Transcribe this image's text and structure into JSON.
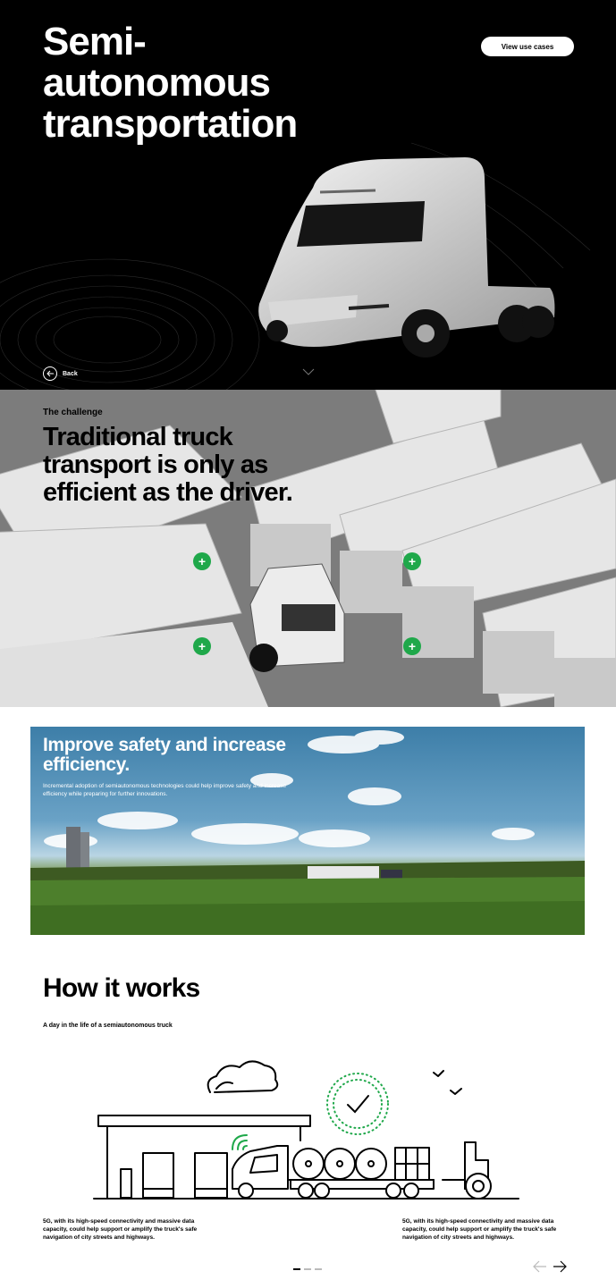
{
  "hero": {
    "title": "Semi-\nautonomous\ntransportation",
    "view_use_cases_label": "View use cases",
    "back_label": "Back"
  },
  "challenge": {
    "eyebrow": "The challenge",
    "title": "Traditional truck transport is only as efficient as the driver.",
    "hotspot_symbol": "+"
  },
  "safety": {
    "title": "Improve safety and increase efficiency.",
    "body": "Incremental adoption of semiautonomous technologies could help improve safety and increase efficiency while preparing for further innovations."
  },
  "how_it_works": {
    "title": "How it works",
    "subtitle": "A day in the life of a semiautonomous truck",
    "caption_left": "5G, with its high-speed connectivity and massive data capacity, could help support or amplify the truck's safe navigation of city streets and highways.",
    "caption_right": "5G, with its high-speed connectivity and massive data capacity, could help support or amplify the truck's safe navigation of city streets and highways."
  },
  "colors": {
    "accent_green": "#1fa84a",
    "hero_bg": "#000000"
  }
}
